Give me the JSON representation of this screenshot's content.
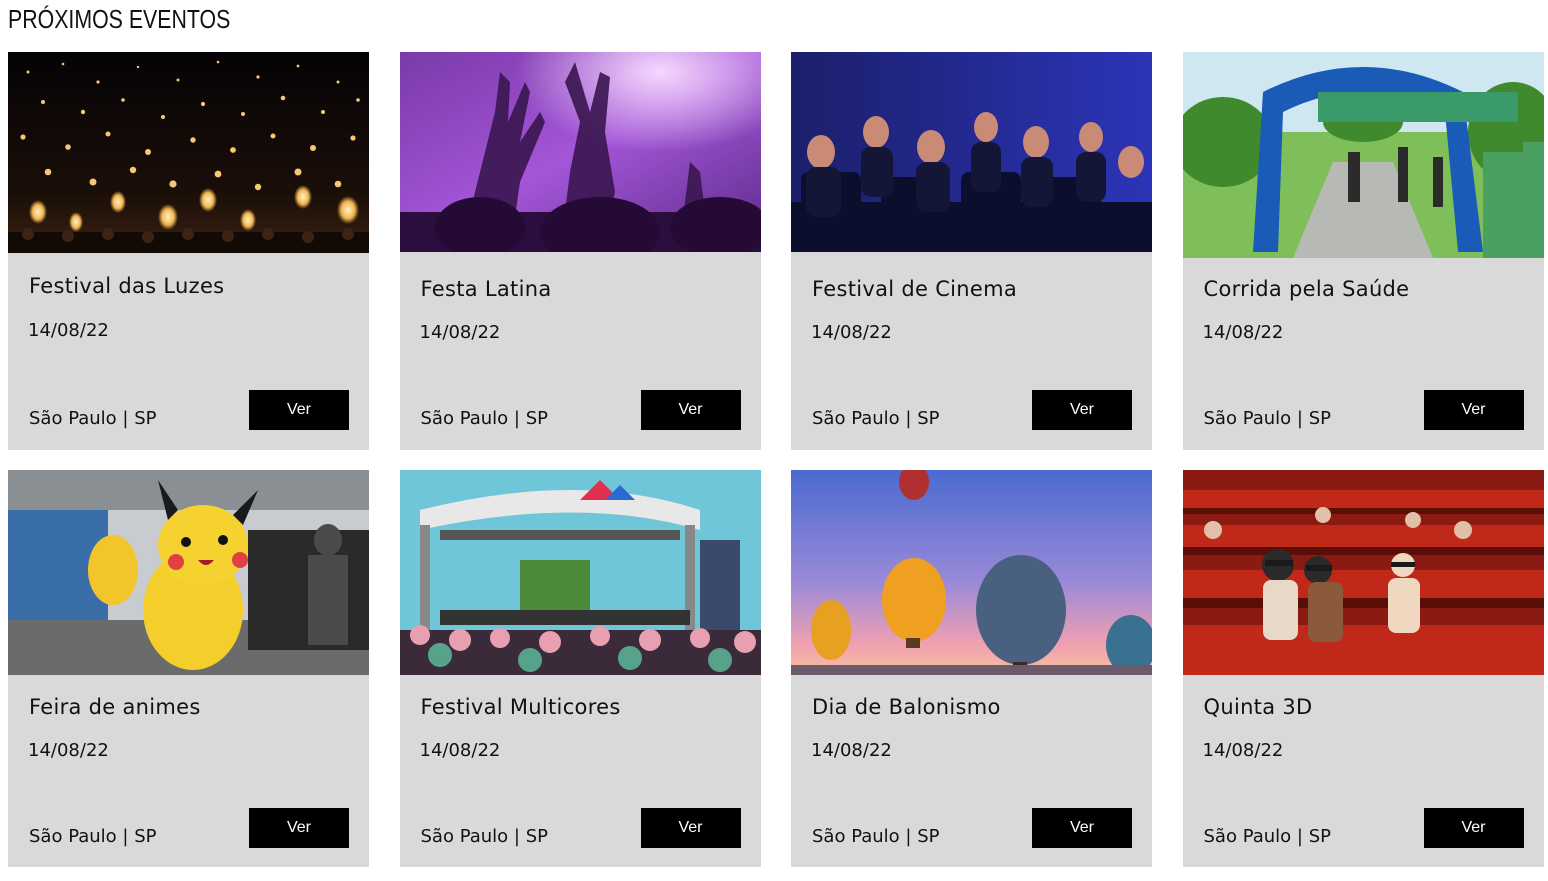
{
  "section": {
    "title": "PRÓXIMOS EVENTOS"
  },
  "events": [
    {
      "title": "Festival das Luzes",
      "date": "14/08/22",
      "location": "São Paulo | SP",
      "button": "Ver",
      "image": "lanterns-photo"
    },
    {
      "title": "Festa Latina",
      "date": "14/08/22",
      "location": "São Paulo | SP",
      "button": "Ver",
      "image": "concert-crowd-photo"
    },
    {
      "title": "Festival de Cinema",
      "date": "14/08/22",
      "location": "São Paulo | SP",
      "button": "Ver",
      "image": "cinema-audience-photo"
    },
    {
      "title": "Corrida pela Saúde",
      "date": "14/08/22",
      "location": "São Paulo | SP",
      "button": "Ver",
      "image": "race-finish-arch-photo"
    },
    {
      "title": "Feira de animes",
      "date": "14/08/22",
      "location": "São Paulo | SP",
      "button": "Ver",
      "image": "pikachu-parade-photo"
    },
    {
      "title": "Festival Multicores",
      "date": "14/08/22",
      "location": "São Paulo | SP",
      "button": "Ver",
      "image": "outdoor-stage-photo"
    },
    {
      "title": "Dia de Balonismo",
      "date": "14/08/22",
      "location": "São Paulo | SP",
      "button": "Ver",
      "image": "hot-air-balloons-photo"
    },
    {
      "title": "Quinta 3D",
      "date": "14/08/22",
      "location": "São Paulo | SP",
      "button": "Ver",
      "image": "3d-cinema-photo"
    }
  ],
  "colors": {
    "card_bg": "#d9d9d9",
    "button_bg": "#000000",
    "button_text": "#ffffff"
  }
}
